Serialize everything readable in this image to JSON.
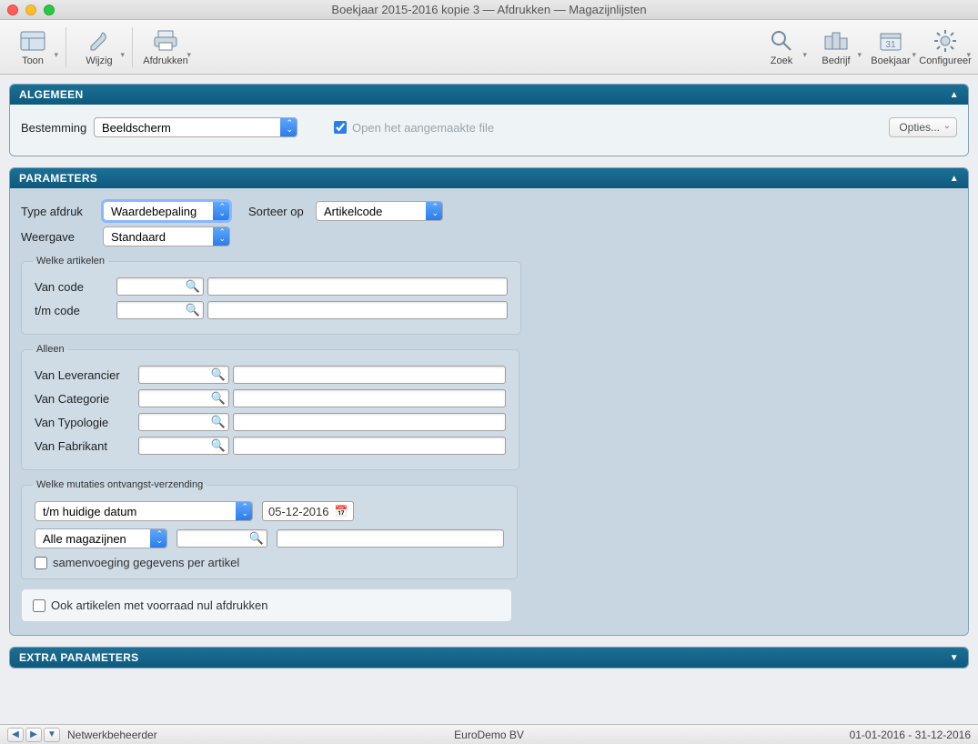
{
  "window": {
    "title": "Boekjaar 2015-2016 kopie 3 — Afdrukken — Magazijnlijsten"
  },
  "toolbar": {
    "left": [
      {
        "id": "toon",
        "label": "Toon"
      },
      {
        "id": "wijzig",
        "label": "Wijzig"
      },
      {
        "id": "afdrukken",
        "label": "Afdrukken"
      }
    ],
    "right": [
      {
        "id": "zoek",
        "label": "Zoek"
      },
      {
        "id": "bedrijf",
        "label": "Bedrijf"
      },
      {
        "id": "boekjaar",
        "label": "Boekjaar"
      },
      {
        "id": "configureer",
        "label": "Configureer"
      }
    ]
  },
  "sections": {
    "algemeen": {
      "title": "ALGEMEEN",
      "bestemming_label": "Bestemming",
      "bestemming_value": "Beeldscherm",
      "open_file_label": "Open het aangemaakte file",
      "open_file_checked": true,
      "opties_label": "Opties..."
    },
    "parameters": {
      "title": "PARAMETERS",
      "type_afdruk_label": "Type afdruk",
      "type_afdruk_value": "Waardebepaling",
      "sorteer_op_label": "Sorteer op",
      "sorteer_op_value": "Artikelcode",
      "weergave_label": "Weergave",
      "weergave_value": "Standaard",
      "welke_artikelen": {
        "legend": "Welke artikelen",
        "van_code_label": "Van code",
        "tm_code_label": "t/m code"
      },
      "alleen": {
        "legend": "Alleen",
        "rows": [
          {
            "label": "Van Leverancier"
          },
          {
            "label": "Van Categorie"
          },
          {
            "label": "Van Typologie"
          },
          {
            "label": "Van Fabrikant"
          }
        ]
      },
      "mutaties": {
        "legend": "Welke mutaties ontvangst-verzending",
        "date_mode_value": "t/m huidige datum",
        "date_value": "05-12-2016",
        "magazijn_value": "Alle magazijnen",
        "samenvoeging_label": "samenvoeging gegevens per artikel",
        "samenvoeging_checked": false
      },
      "ook_nul": {
        "label": "Ook artikelen met voorraad nul afdrukken",
        "checked": false
      }
    },
    "extra": {
      "title": "EXTRA PARAMETERS"
    }
  },
  "statusbar": {
    "user": "Netwerkbeheerder",
    "company": "EuroDemo BV",
    "period": "01-01-2016 - 31-12-2016"
  }
}
